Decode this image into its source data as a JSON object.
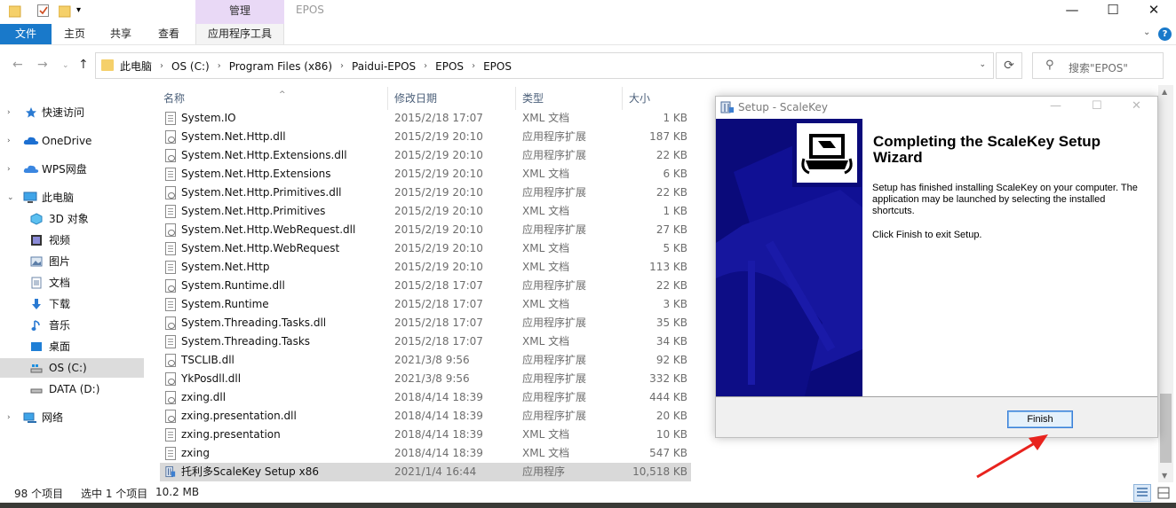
{
  "titlebar": {
    "contextual_tab": "管理",
    "window_title": "EPOS",
    "min": "—",
    "max": "☐",
    "close": "✕"
  },
  "ribbon": {
    "tabs": [
      "文件",
      "主页",
      "共享",
      "查看",
      "应用程序工具"
    ]
  },
  "address": {
    "crumbs": [
      "此电脑",
      "OS (C:)",
      "Program Files (x86)",
      "Paidui-EPOS",
      "EPOS",
      "EPOS"
    ],
    "search_placeholder": "搜索\"EPOS\""
  },
  "nav": {
    "items": [
      {
        "label": "快速访问",
        "icon": "star-icon"
      },
      {
        "label": "OneDrive",
        "icon": "cloud-icon"
      },
      {
        "label": "WPS网盘",
        "icon": "cloud-icon"
      },
      {
        "label": "此电脑",
        "icon": "computer-icon"
      },
      {
        "label": "3D 对象",
        "icon": "cube-icon"
      },
      {
        "label": "视频",
        "icon": "video-icon"
      },
      {
        "label": "图片",
        "icon": "picture-icon"
      },
      {
        "label": "文档",
        "icon": "document-icon"
      },
      {
        "label": "下载",
        "icon": "download-icon"
      },
      {
        "label": "音乐",
        "icon": "music-icon"
      },
      {
        "label": "桌面",
        "icon": "desktop-icon"
      },
      {
        "label": "OS (C:)",
        "icon": "drive-icon"
      },
      {
        "label": "DATA (D:)",
        "icon": "drive-icon"
      },
      {
        "label": "网络",
        "icon": "network-icon"
      }
    ]
  },
  "columns": {
    "name": "名称",
    "date": "修改日期",
    "type": "类型",
    "size": "大小"
  },
  "files": [
    {
      "name": "System.IO",
      "date": "2015/2/18 17:07",
      "type": "XML 文档",
      "size": "1 KB",
      "kind": "xml"
    },
    {
      "name": "System.Net.Http.dll",
      "date": "2015/2/19 20:10",
      "type": "应用程序扩展",
      "size": "187 KB",
      "kind": "dll"
    },
    {
      "name": "System.Net.Http.Extensions.dll",
      "date": "2015/2/19 20:10",
      "type": "应用程序扩展",
      "size": "22 KB",
      "kind": "dll"
    },
    {
      "name": "System.Net.Http.Extensions",
      "date": "2015/2/19 20:10",
      "type": "XML 文档",
      "size": "6 KB",
      "kind": "xml"
    },
    {
      "name": "System.Net.Http.Primitives.dll",
      "date": "2015/2/19 20:10",
      "type": "应用程序扩展",
      "size": "22 KB",
      "kind": "dll"
    },
    {
      "name": "System.Net.Http.Primitives",
      "date": "2015/2/19 20:10",
      "type": "XML 文档",
      "size": "1 KB",
      "kind": "xml"
    },
    {
      "name": "System.Net.Http.WebRequest.dll",
      "date": "2015/2/19 20:10",
      "type": "应用程序扩展",
      "size": "27 KB",
      "kind": "dll"
    },
    {
      "name": "System.Net.Http.WebRequest",
      "date": "2015/2/19 20:10",
      "type": "XML 文档",
      "size": "5 KB",
      "kind": "xml"
    },
    {
      "name": "System.Net.Http",
      "date": "2015/2/19 20:10",
      "type": "XML 文档",
      "size": "113 KB",
      "kind": "xml"
    },
    {
      "name": "System.Runtime.dll",
      "date": "2015/2/18 17:07",
      "type": "应用程序扩展",
      "size": "22 KB",
      "kind": "dll"
    },
    {
      "name": "System.Runtime",
      "date": "2015/2/18 17:07",
      "type": "XML 文档",
      "size": "3 KB",
      "kind": "xml"
    },
    {
      "name": "System.Threading.Tasks.dll",
      "date": "2015/2/18 17:07",
      "type": "应用程序扩展",
      "size": "35 KB",
      "kind": "dll"
    },
    {
      "name": "System.Threading.Tasks",
      "date": "2015/2/18 17:07",
      "type": "XML 文档",
      "size": "34 KB",
      "kind": "xml"
    },
    {
      "name": "TSCLIB.dll",
      "date": "2021/3/8 9:56",
      "type": "应用程序扩展",
      "size": "92 KB",
      "kind": "dll"
    },
    {
      "name": "YkPosdll.dll",
      "date": "2021/3/8 9:56",
      "type": "应用程序扩展",
      "size": "332 KB",
      "kind": "dll"
    },
    {
      "name": "zxing.dll",
      "date": "2018/4/14 18:39",
      "type": "应用程序扩展",
      "size": "444 KB",
      "kind": "dll"
    },
    {
      "name": "zxing.presentation.dll",
      "date": "2018/4/14 18:39",
      "type": "应用程序扩展",
      "size": "20 KB",
      "kind": "dll"
    },
    {
      "name": "zxing.presentation",
      "date": "2018/4/14 18:39",
      "type": "XML 文档",
      "size": "10 KB",
      "kind": "xml"
    },
    {
      "name": "zxing",
      "date": "2018/4/14 18:39",
      "type": "XML 文档",
      "size": "547 KB",
      "kind": "xml"
    },
    {
      "name": "托利多ScaleKey Setup x86",
      "date": "2021/1/4 16:44",
      "type": "应用程序",
      "size": "10,518 KB",
      "kind": "exe",
      "selected": true
    }
  ],
  "status": {
    "count": "98 个项目",
    "selection": "选中 1 个项目",
    "size": "10.2 MB"
  },
  "dialog": {
    "title": "Setup - ScaleKey",
    "heading": "Completing the ScaleKey Setup Wizard",
    "body": "Setup has finished installing ScaleKey on your computer. The application may be launched by selecting the installed shortcuts.",
    "body2": "Click Finish to exit Setup.",
    "finish_label": "Finish"
  },
  "colors": {
    "accent": "#1979ca",
    "manage_tab": "#e9d9f6",
    "banner": "#0a0a7a",
    "annotation_arrow": "#e8231e"
  }
}
